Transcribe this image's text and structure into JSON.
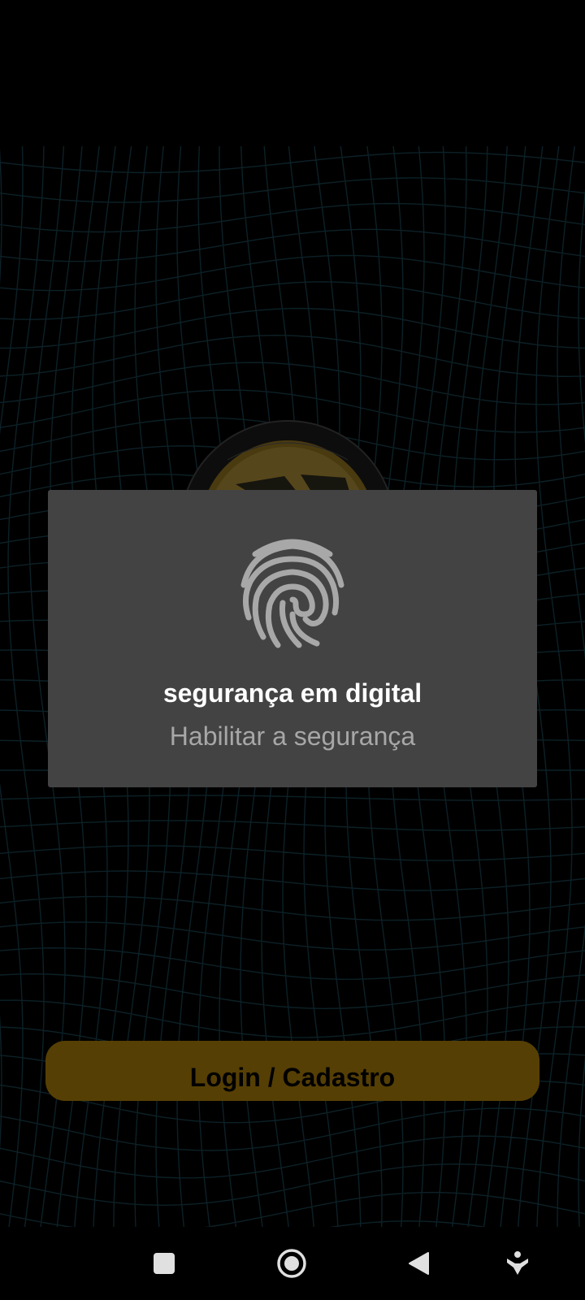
{
  "dialog": {
    "title": "segurança em digital",
    "subtitle": "Habilitar a segurança"
  },
  "login_button": {
    "label": "Login / Cadastro"
  },
  "icons": {
    "dialog_icon": "fingerprint-icon",
    "nav": [
      "square-icon",
      "circle-icon",
      "back-triangle-icon",
      "accessibility-icon"
    ]
  },
  "colors": {
    "background": "#000000",
    "dialog_bg": "#434343",
    "dialog_title": "#ffffff",
    "dialog_subtitle": "#a7a7a7",
    "button_bg": "#6a4e05",
    "fingerprint": "#a8a8a8",
    "grid": "#123038"
  }
}
